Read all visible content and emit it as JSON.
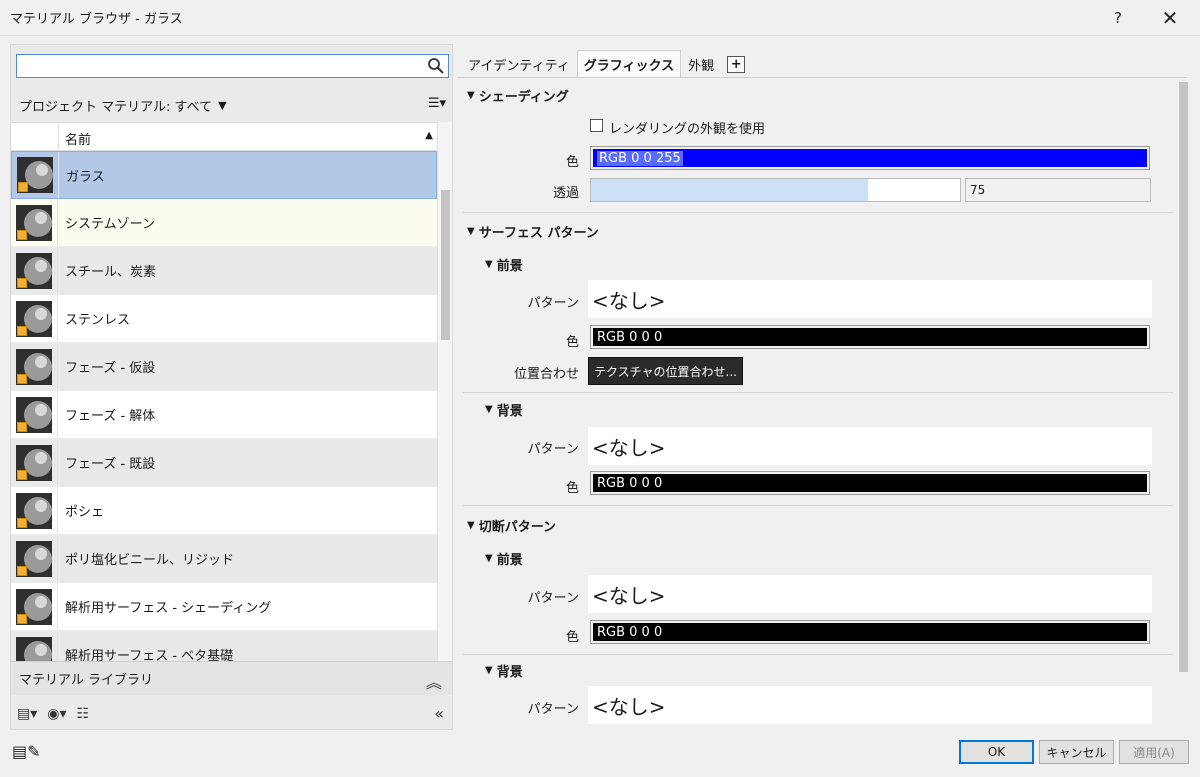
{
  "window": {
    "title": "マテリアル ブラウザ - ガラス",
    "help_glyph": "?",
    "close_glyph": "✕"
  },
  "left": {
    "search_placeholder": "",
    "project_filter_label": "プロジェクト マテリアル: すべて",
    "column_name": "名前",
    "materials": [
      {
        "name": "ガラス",
        "state": "selected"
      },
      {
        "name": "システムゾーン",
        "state": "highlight"
      },
      {
        "name": "スチール、炭素",
        "state": "alt"
      },
      {
        "name": "ステンレス",
        "state": "normal"
      },
      {
        "name": "フェーズ - 仮設",
        "state": "alt"
      },
      {
        "name": "フェーズ - 解体",
        "state": "normal"
      },
      {
        "name": "フェーズ - 既設",
        "state": "alt"
      },
      {
        "name": "ポシェ",
        "state": "normal"
      },
      {
        "name": "ポリ塩化ビニール、リジッド",
        "state": "alt"
      },
      {
        "name": "解析用サーフェス - シェーディング",
        "state": "normal"
      },
      {
        "name": "解析用サーフェス - ベタ基礎",
        "state": "alt"
      }
    ],
    "library_label": "マテリアル ライブラリ"
  },
  "tabs": [
    {
      "label": "アイデンティティ",
      "active": false
    },
    {
      "label": "グラフィックス",
      "active": true
    },
    {
      "label": "外観",
      "active": false
    }
  ],
  "tab_add_label": "+",
  "props": {
    "shading": {
      "title": "シェーディング",
      "use_render_label": "レンダリングの外観を使用",
      "color_label": "色",
      "color_value": "RGB 0 0 255",
      "color_hex": "#0000ff",
      "transparency_label": "透過",
      "transparency_value": "75",
      "transparency_fraction": 0.75
    },
    "surface_pattern": {
      "title": "サーフェス パターン",
      "foreground": {
        "title": "前景",
        "pattern_label": "パターン",
        "pattern_value": "<なし>",
        "color_label": "色",
        "color_value": "RGB 0 0 0",
        "align_label": "位置合わせ",
        "align_button": "テクスチャの位置合わせ..."
      },
      "background": {
        "title": "背景",
        "pattern_label": "パターン",
        "pattern_value": "<なし>",
        "color_label": "色",
        "color_value": "RGB 0 0 0"
      }
    },
    "cut_pattern": {
      "title": "切断パターン",
      "foreground": {
        "title": "前景",
        "pattern_label": "パターン",
        "pattern_value": "<なし>",
        "color_label": "色",
        "color_value": "RGB 0 0 0"
      },
      "background": {
        "title": "背景",
        "pattern_label": "パターン",
        "pattern_value": "<なし>"
      }
    }
  },
  "buttons": {
    "ok": "OK",
    "cancel": "キャンセル",
    "apply": "適用(A)"
  },
  "colors": {
    "accent": "#0078d7",
    "selection": "#b1c9e6",
    "transparency_fill": "#cce0f6"
  }
}
